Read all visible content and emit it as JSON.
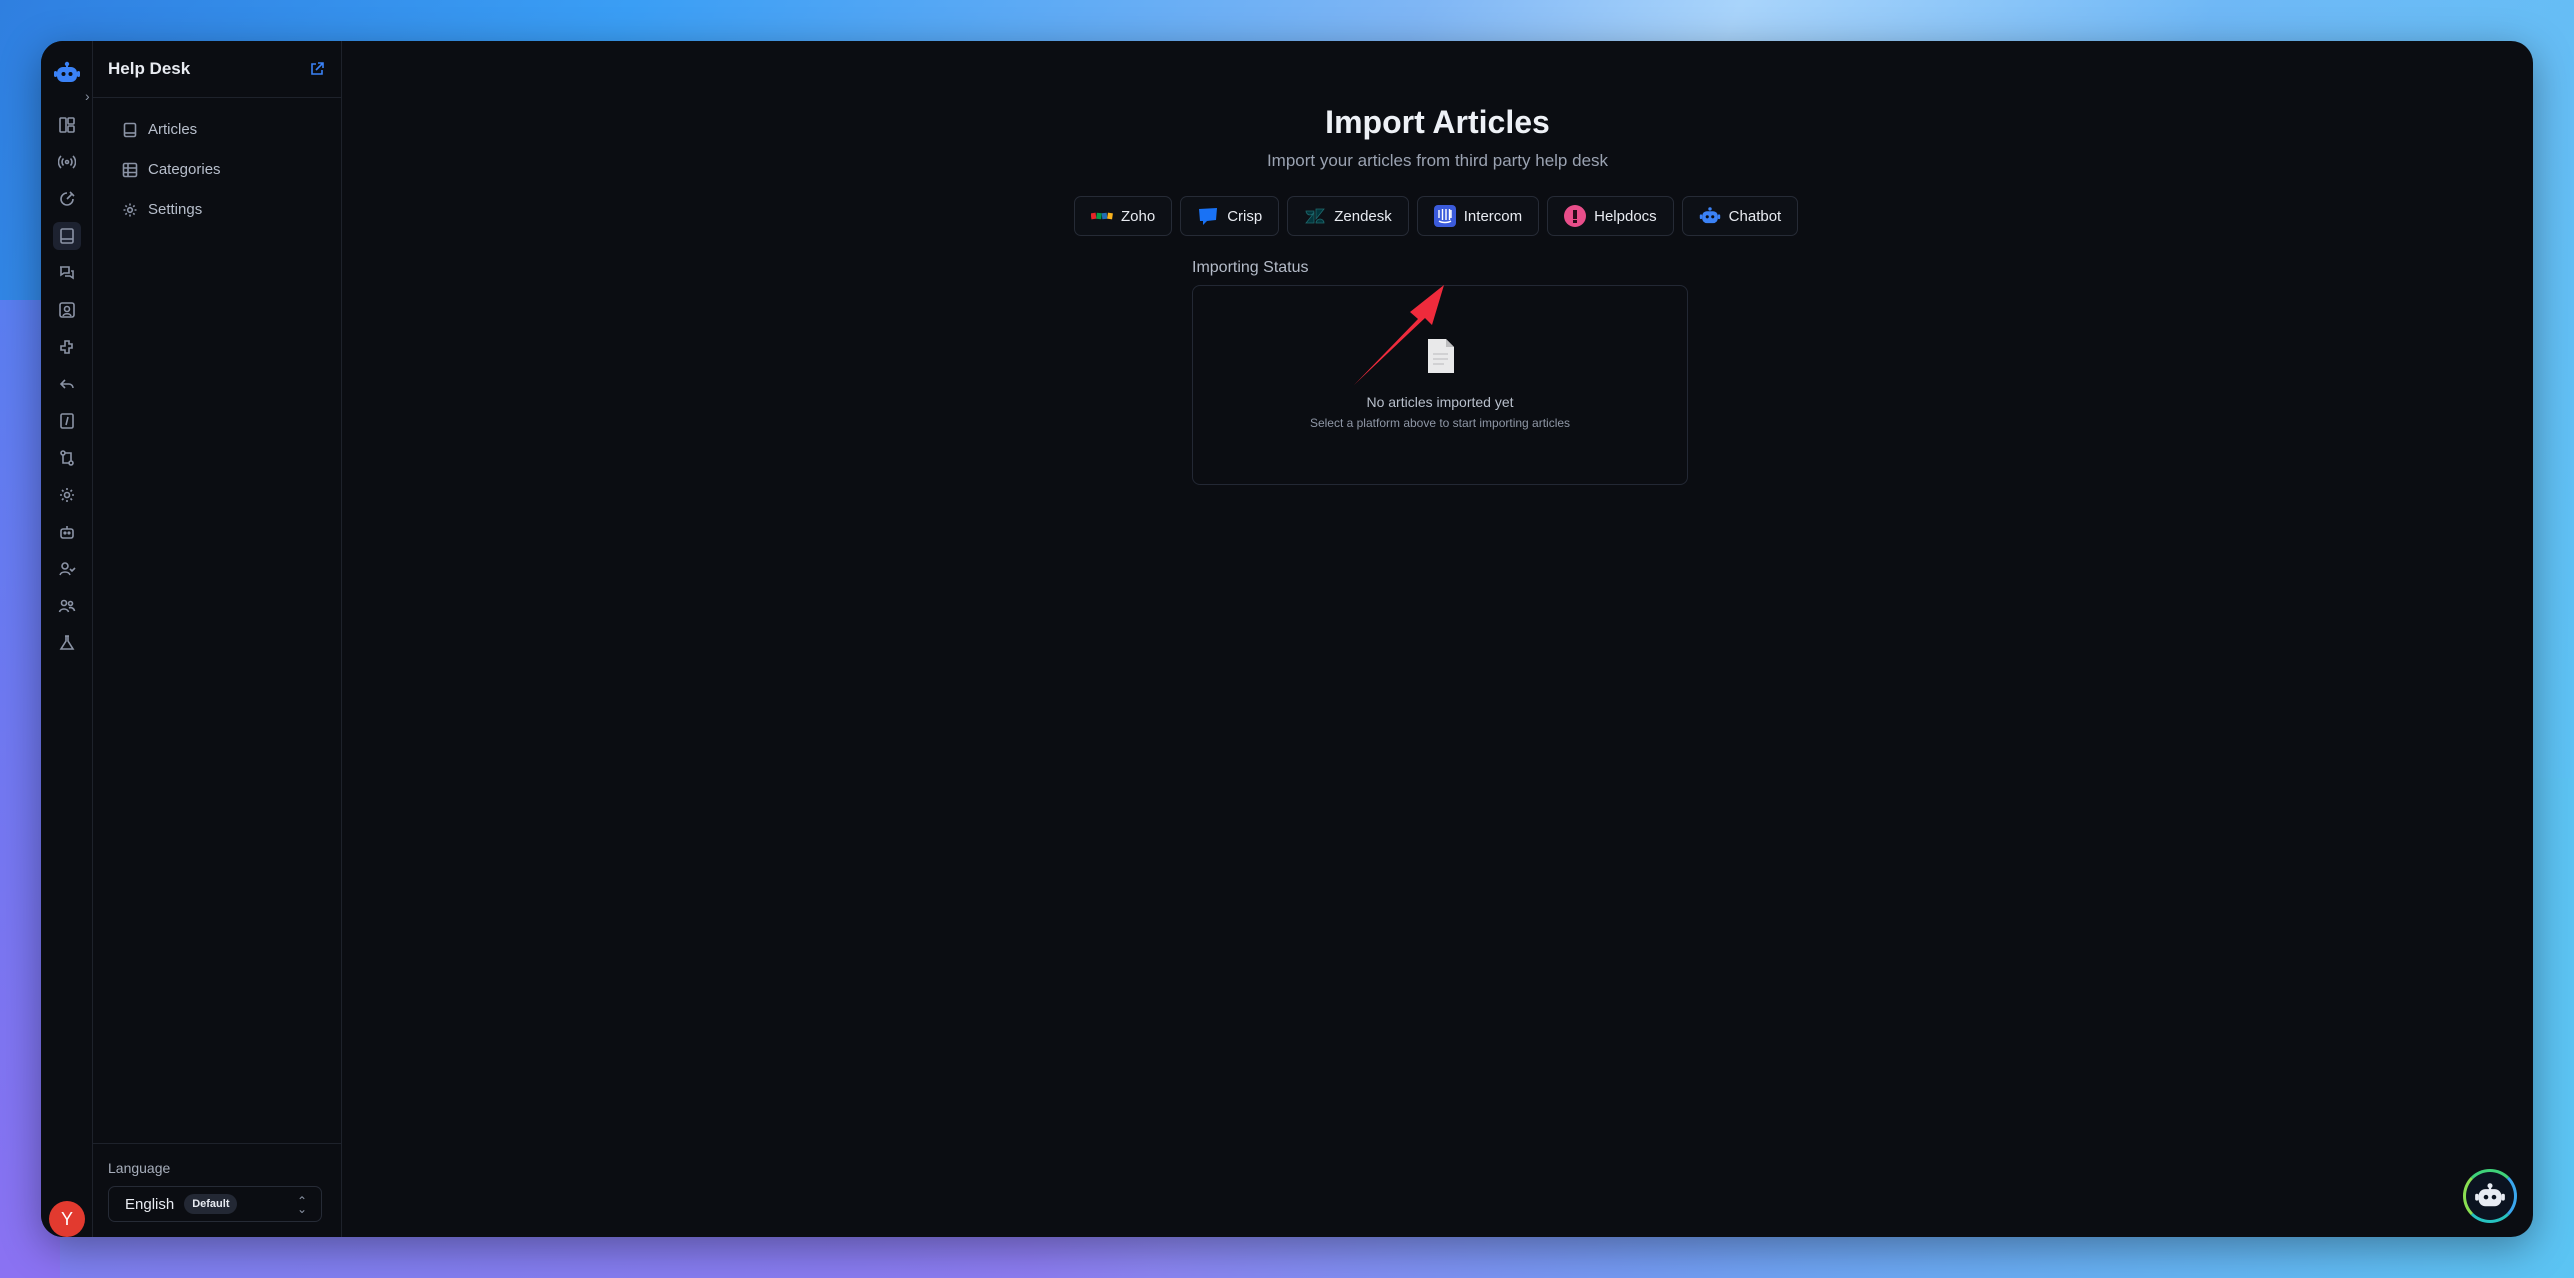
{
  "app": {
    "section_title": "Help Desk"
  },
  "rail": {
    "icons": [
      "dashboard-icon",
      "broadcast-icon",
      "inbox-icon",
      "book-icon",
      "chat-icon",
      "contact-icon",
      "puzzle-icon",
      "reply-icon",
      "file-icon",
      "workflow-icon",
      "gear-icon",
      "bot-icon",
      "user-check-icon",
      "users-icon",
      "flask-icon"
    ],
    "avatar_initial": "Y"
  },
  "sidebar": {
    "items": [
      {
        "label": "Articles",
        "icon": "book-icon"
      },
      {
        "label": "Categories",
        "icon": "grid-icon"
      },
      {
        "label": "Settings",
        "icon": "gear-icon"
      }
    ],
    "language_label": "Language",
    "language_value": "English",
    "language_badge": "Default"
  },
  "main": {
    "title": "Import Articles",
    "subtitle": "Import your articles from third party help desk",
    "providers": [
      {
        "label": "Zoho",
        "icon": "zoho-icon"
      },
      {
        "label": "Crisp",
        "icon": "crisp-icon"
      },
      {
        "label": "Zendesk",
        "icon": "zendesk-icon"
      },
      {
        "label": "Intercom",
        "icon": "intercom-icon"
      },
      {
        "label": "Helpdocs",
        "icon": "helpdocs-icon"
      },
      {
        "label": "Chatbot",
        "icon": "chatbot-icon"
      }
    ],
    "status_label": "Importing Status",
    "empty_title": "No articles imported yet",
    "empty_subtitle": "Select a platform above to start importing articles"
  },
  "colors": {
    "accent": "#3b82f6",
    "background": "#0b0d12",
    "arrow": "#ef2b3c",
    "avatar": "#e23a2f"
  }
}
